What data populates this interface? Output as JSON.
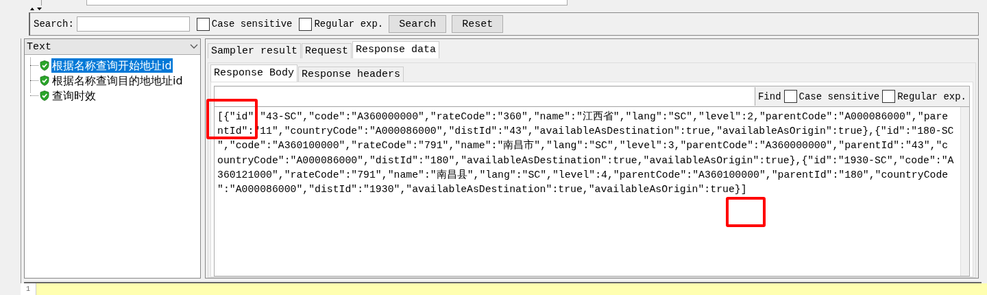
{
  "search_bar": {
    "label": "Search:",
    "options": [
      {
        "label": "Case sensitive",
        "checked": false
      },
      {
        "label": "Regular exp.",
        "checked": false
      }
    ],
    "buttons": [
      "Search",
      "Reset"
    ]
  },
  "result_view": {
    "renderer": "Text"
  },
  "tree": {
    "items": [
      {
        "label": "根据名称查询开始地址id",
        "selected": true
      },
      {
        "label": "根据名称查询目的地地址id",
        "selected": false
      },
      {
        "label": "查询时效",
        "selected": false
      }
    ]
  },
  "tabs": [
    {
      "label": "Sampler result",
      "selected": false
    },
    {
      "label": "Request",
      "selected": false
    },
    {
      "label": "Response data",
      "selected": true
    }
  ],
  "subtabs": [
    {
      "label": "Response Body",
      "selected": true
    },
    {
      "label": "Response headers",
      "selected": false
    }
  ],
  "find_bar": {
    "label": "Find",
    "options": [
      {
        "label": "Case sensitive",
        "checked": false
      },
      {
        "label": "Regular exp.",
        "checked": false
      }
    ]
  },
  "response_lines": [
    "[{\"id\":\"43-SC\",\"code\":\"A360000000\",\"rateCode\":\"360\",\"name\":\"江西省\",\"lang\":\"SC\",\"level\":2,\"parentCode\":\"A000086000\",\"pare",
    "ntId\":\"11\",\"countryCode\":\"A000086000\",\"distId\":\"43\",\"availableAsDestination\":true,\"availableAsOrigin\":true},{\"id\":\"180-SC",
    "\",\"code\":\"A360100000\",\"rateCode\":\"791\",\"name\":\"南昌市\",\"lang\":\"SC\",\"level\":3,\"parentCode\":\"A360000000\",\"parentId\":\"43\",\"c",
    "ountryCode\":\"A000086000\",\"distId\":\"180\",\"availableAsDestination\":true,\"availableAsOrigin\":true},{\"id\":\"1930-SC\",\"code\":\"A",
    "360121000\",\"rateCode\":\"791\",\"name\":\"南昌县\",\"lang\":\"SC\",\"level\":4,\"parentCode\":\"A360100000\",\"parentId\":\"180\",\"countryCode",
    "\":\"A000086000\",\"distId\":\"1930\",\"availableAsDestination\":true,\"availableAsOrigin\":true}]"
  ],
  "highlights": [
    {
      "kind": "rectangle"
    },
    {
      "kind": "rectangle"
    }
  ],
  "editor": {
    "line_numbers": [
      "1"
    ]
  }
}
